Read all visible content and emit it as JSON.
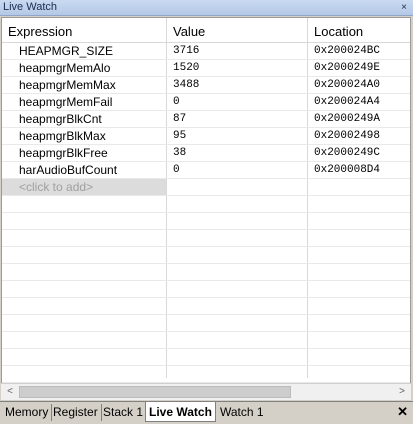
{
  "window": {
    "title": "Live Watch",
    "close_glyph": "×"
  },
  "columns": [
    "Expression",
    "Value",
    "Location"
  ],
  "rows": [
    {
      "expression": "HEAPMGR_SIZE",
      "value": "3716",
      "location": "0x200024BC"
    },
    {
      "expression": "heapmgrMemAlo",
      "value": "1520",
      "location": "0x2000249E"
    },
    {
      "expression": "heapmgrMemMax",
      "value": "3488",
      "location": "0x200024A0"
    },
    {
      "expression": "heapmgrMemFail",
      "value": "0",
      "location": "0x200024A4"
    },
    {
      "expression": "heapmgrBlkCnt",
      "value": "87",
      "location": "0x2000249A"
    },
    {
      "expression": "heapmgrBlkMax",
      "value": "95",
      "location": "0x20002498"
    },
    {
      "expression": "heapmgrBlkFree",
      "value": "38",
      "location": "0x2000249C"
    },
    {
      "expression": "harAudioBufCount",
      "value": "0",
      "location": "0x200008D4"
    }
  ],
  "add_row": {
    "placeholder": "<click to add>"
  },
  "scrollbar": {
    "left_arrow": "<",
    "right_arrow": ">"
  },
  "tabs": [
    {
      "label": "Memory"
    },
    {
      "label": "Register"
    },
    {
      "label": "Stack 1"
    },
    {
      "label": "Live Watch",
      "active": true
    },
    {
      "label": "Watch 1"
    }
  ],
  "tabbar": {
    "close_glyph": "✕"
  }
}
